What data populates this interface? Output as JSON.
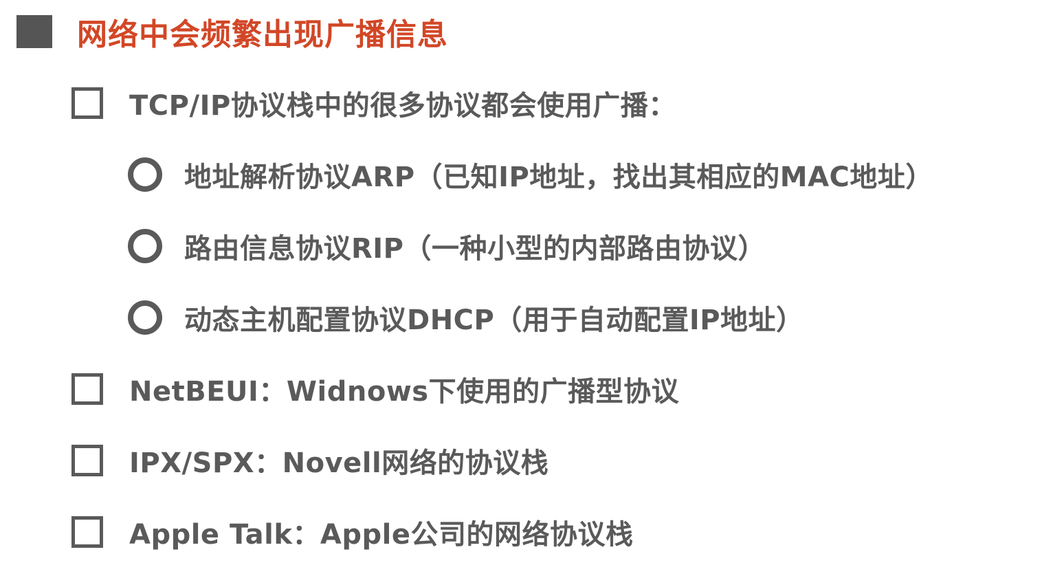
{
  "heading": {
    "text": "网络中会频繁出现广播信息"
  },
  "items": [
    {
      "level": 1,
      "text": "TCP/IP协议栈中的很多协议都会使用广播："
    },
    {
      "level": 2,
      "text": "地址解析协议ARP（已知IP地址，找出其相应的MAC地址）"
    },
    {
      "level": 2,
      "text": "路由信息协议RIP（一种小型的内部路由协议）"
    },
    {
      "level": 2,
      "text": "动态主机配置协议DHCP（用于自动配置IP地址）"
    },
    {
      "level": 1,
      "text": "NetBEUI：Widnows下使用的广播型协议"
    },
    {
      "level": 1,
      "text": "IPX/SPX：Novell网络的协议栈"
    },
    {
      "level": 1,
      "text": "Apple Talk：Apple公司的网络协议栈"
    }
  ],
  "colors": {
    "heading": "#d24726",
    "body_text": "#5a5a5a",
    "bullet": "#555555"
  }
}
